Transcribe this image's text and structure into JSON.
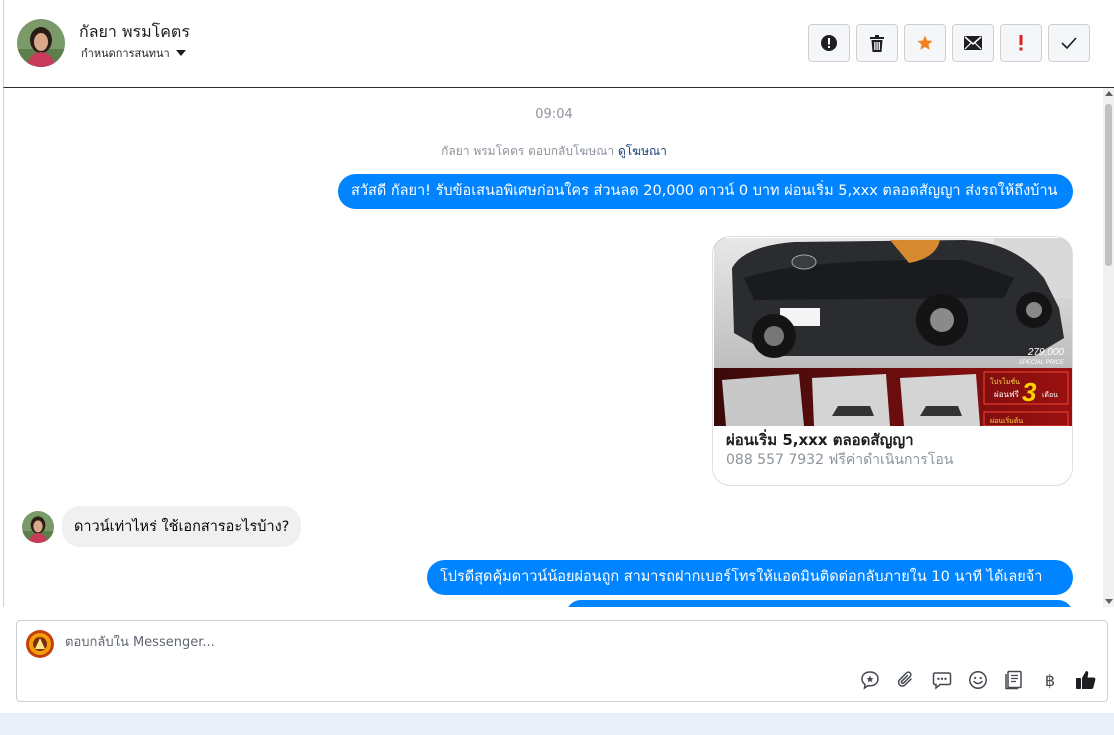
{
  "header": {
    "contact_name": "กัลยา พรมโคตร",
    "assign_label": "กำหนดการสนทนา"
  },
  "actions": [
    {
      "icon": "alert-circle-icon",
      "color": "#1c1e21"
    },
    {
      "icon": "trash-icon",
      "color": "#1c1e21"
    },
    {
      "icon": "star-icon",
      "color": "#f5821f"
    },
    {
      "icon": "envelope-icon",
      "color": "#1c1e21"
    },
    {
      "icon": "exclamation-icon",
      "color": "#e02020"
    },
    {
      "icon": "check-icon",
      "color": "#1c1e21"
    }
  ],
  "chat": {
    "time": "09:04",
    "notice_text": "กัลยา พรมโคตร ตอบกลับโฆษณา",
    "notice_link": "ดูโฆษณา",
    "msg1": "สวัสดี กัลยา! รับข้อเสนอพิเศษก่อนใคร ส่วนลด 20,000 ดาวน์ 0 บาท ผ่อนเริ่ม 5,xxx ตลอดสัญญา ส่งรถให้ถึงบ้าน",
    "card": {
      "title": "ผ่อนเริ่ม 5,xxx ตลอดสัญญา",
      "subtitle": "088 557 7932 ฟรีค่าดำเนินการโอน",
      "image_price": "279,000",
      "image_price_sub": "SPECIAL PRICE",
      "image_promo_small": "โปรโมชั่น",
      "image_promo_free": "ผ่อนฟรี",
      "image_promo_number": "3",
      "image_promo_unit": "เดือน",
      "image_promo_bottom": "ผ่อนเริ่มต้น"
    },
    "msg_in": "ดาวน์เท่าไหร่ ใช้เอกสารอะไรบ้าง?",
    "msg2": "โปรดีสุดคุ้มดาวน์น้อยผ่อนถูก สามารถฝากเบอร์โทรให้แอดมินติดต่อกลับภายใน 10 นาที ได้เลยจ้า"
  },
  "composer": {
    "placeholder": "ตอบกลับใน Messenger...",
    "currency_glyph": "฿"
  },
  "colors": {
    "outgoing_bubble": "#0084ff",
    "incoming_bubble": "#f0f0f0",
    "accent_star": "#f5821f",
    "accent_alert": "#e02020"
  }
}
